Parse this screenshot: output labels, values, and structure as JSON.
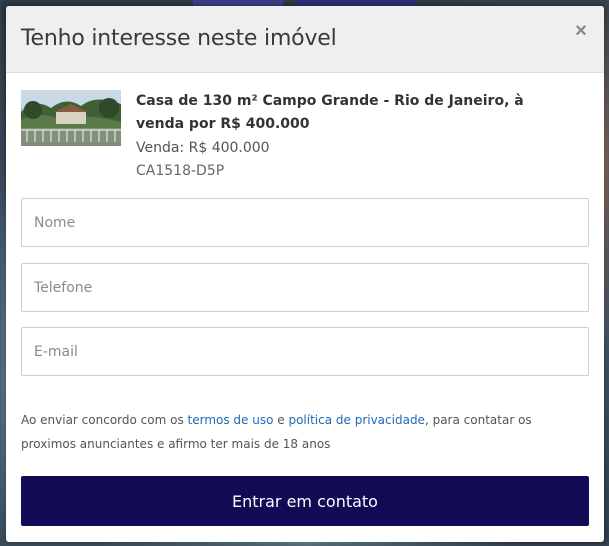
{
  "modal": {
    "title": "Tenho interesse neste imóvel",
    "close_label": "×"
  },
  "listing": {
    "title": "Casa de 130 m² Campo Grande - Rio de Janeiro, à venda por R$ 400.000",
    "price": "Venda: R$ 400.000",
    "code": "CA1518-D5P"
  },
  "form": {
    "name_placeholder": "Nome",
    "phone_placeholder": "Telefone",
    "email_placeholder": "E-mail"
  },
  "terms": {
    "prefix": "Ao enviar concordo com os ",
    "terms_link": "termos de uso",
    "connector": " e ",
    "privacy_link": "política de privacidade",
    "suffix": ", para contatar os proximos anunciantes e afirmo ter mais de 18 anos"
  },
  "submit_label": "Entrar em contato",
  "colors": {
    "submit_bg": "#110a55",
    "link": "#1e6bb8",
    "header_bg": "#efefef"
  }
}
